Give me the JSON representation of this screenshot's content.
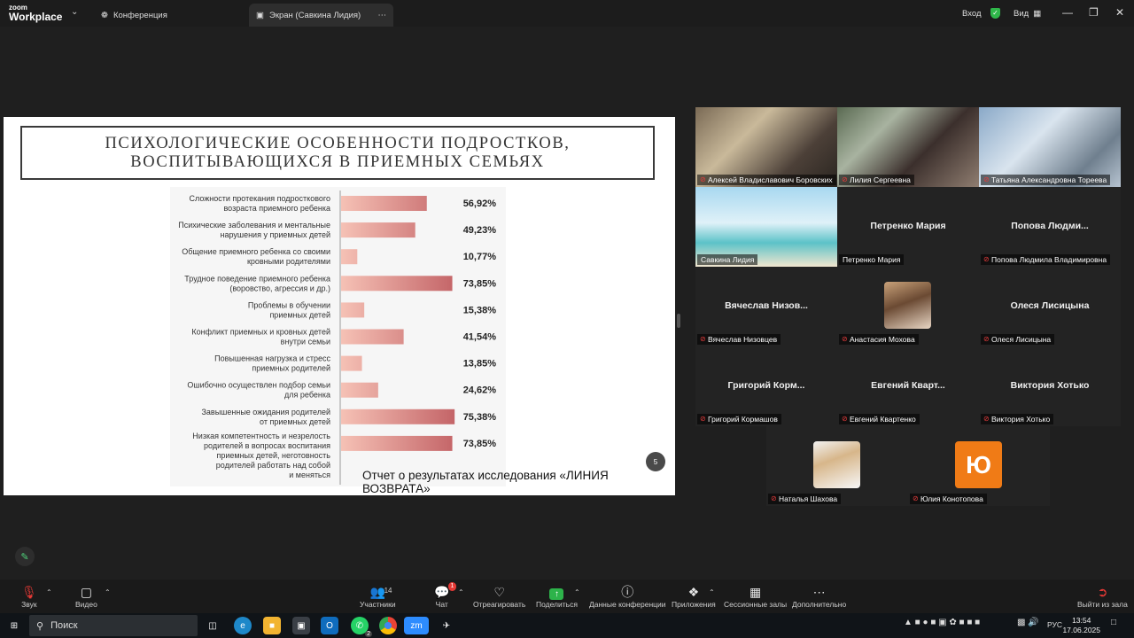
{
  "titlebar": {
    "logo_line1": "zoom",
    "logo_line2": "Workplace",
    "tab_conference": "Конференция",
    "tab_screen": "Экран (Савкина Лидия)",
    "signin": "Вход",
    "view": "Вид"
  },
  "slide": {
    "title_line1": "ПСИХОЛОГИЧЕСКИЕ ОСОБЕННОСТИ ПОДРОСТКОВ,",
    "title_line2": "ВОСПИТЫВАЮЩИХСЯ В ПРИЕМНЫХ СЕМЬЯХ",
    "footer": "Отчет о результатах исследования «ЛИНИЯ ВОЗВРАТА»",
    "page_number": "5"
  },
  "chart_data": {
    "type": "bar",
    "orientation": "horizontal",
    "categories": [
      [
        "Сложности протекания подросткового",
        "возраста приемного ребенка"
      ],
      [
        "Психические заболевания и ментальные",
        "нарушения у приемных детей"
      ],
      [
        "Общение приемного ребенка со своими",
        "кровными родителями"
      ],
      [
        "Трудное поведение приемного ребенка",
        "(воровство, агрессия и др.)"
      ],
      [
        "Проблемы в обучении",
        "приемных детей"
      ],
      [
        "Конфликт приемных и кровных детей",
        "внутри семьи"
      ],
      [
        "Повышенная нагрузка и стресс",
        "приемных родителей"
      ],
      [
        "Ошибочно осуществлен подбор семьи",
        "для ребенка"
      ],
      [
        "Завышенные ожидания родителей",
        "от приемных детей"
      ],
      [
        "Низкая компетентность и незрелость",
        "родителей в вопросах воспитания",
        "приемных детей, неготовность",
        "родителей работать над собой",
        "и меняться"
      ]
    ],
    "values": [
      56.92,
      49.23,
      10.77,
      73.85,
      15.38,
      41.54,
      13.85,
      24.62,
      75.38,
      73.85
    ],
    "value_labels": [
      "56,92%",
      "49,23%",
      "10,77%",
      "73,85%",
      "15,38%",
      "41,54%",
      "13,85%",
      "24,62%",
      "75,38%",
      "73,85%"
    ],
    "xlim": [
      0,
      100
    ],
    "colors": {
      "low": "#f6c2b6",
      "high": "#b4474f"
    }
  },
  "participants": [
    {
      "name": "Алексей Владиславович Боровских",
      "video": true,
      "muted": true
    },
    {
      "name": "Лилия Сергеевна",
      "video": true,
      "muted": true
    },
    {
      "name": "Татьяна Александровна Тореева",
      "video": true,
      "muted": true
    },
    {
      "name": "Савкина Лидия",
      "video": true,
      "muted": false,
      "active": true
    },
    {
      "name": "Петренко Мария",
      "display": "Петренко Мария",
      "video": false,
      "muted": false
    },
    {
      "name": "Попова Людмила Владимировна",
      "display": "Попова  Людми...",
      "video": false,
      "muted": true
    },
    {
      "name": "Вячеслав Низовцев",
      "display": "Вячеслав  Низов...",
      "video": false,
      "muted": true
    },
    {
      "name": "Анастасия Мохова",
      "video": false,
      "avatar": "photo",
      "muted": true
    },
    {
      "name": "Олеся Лисицына",
      "display": "Олеся Лисицына",
      "video": false,
      "muted": true
    },
    {
      "name": "Григорий Кормашов",
      "display": "Григорий  Корм...",
      "video": false,
      "muted": true
    },
    {
      "name": "Евгений Квартенко",
      "display": "Евгений  Кварт...",
      "video": false,
      "muted": true
    },
    {
      "name": "Виктория Хотько",
      "display": "Виктория Хотько",
      "video": false,
      "muted": true
    },
    {
      "name": "Наталья Шахова",
      "video": false,
      "avatar": "photo",
      "muted": true
    },
    {
      "name": "Юлия Конотопова",
      "video": false,
      "avatar": "letter",
      "letter": "Ю",
      "muted": true
    }
  ],
  "toolbar": {
    "audio": "Звук",
    "video": "Видео",
    "participants": "Участники",
    "participants_count": "14",
    "chat": "Чат",
    "chat_badge": "1",
    "react": "Отреагировать",
    "share": "Поделиться",
    "meeting_info": "Данные конференции",
    "apps": "Приложения",
    "breakout": "Сессионные залы",
    "more": "Дополнительно",
    "leave": "Выйти из зала"
  },
  "taskbar": {
    "search": "Поиск",
    "lang": "РУС",
    "time": "13:54",
    "date": "17.06.2025",
    "whatsapp_badge": "2"
  }
}
